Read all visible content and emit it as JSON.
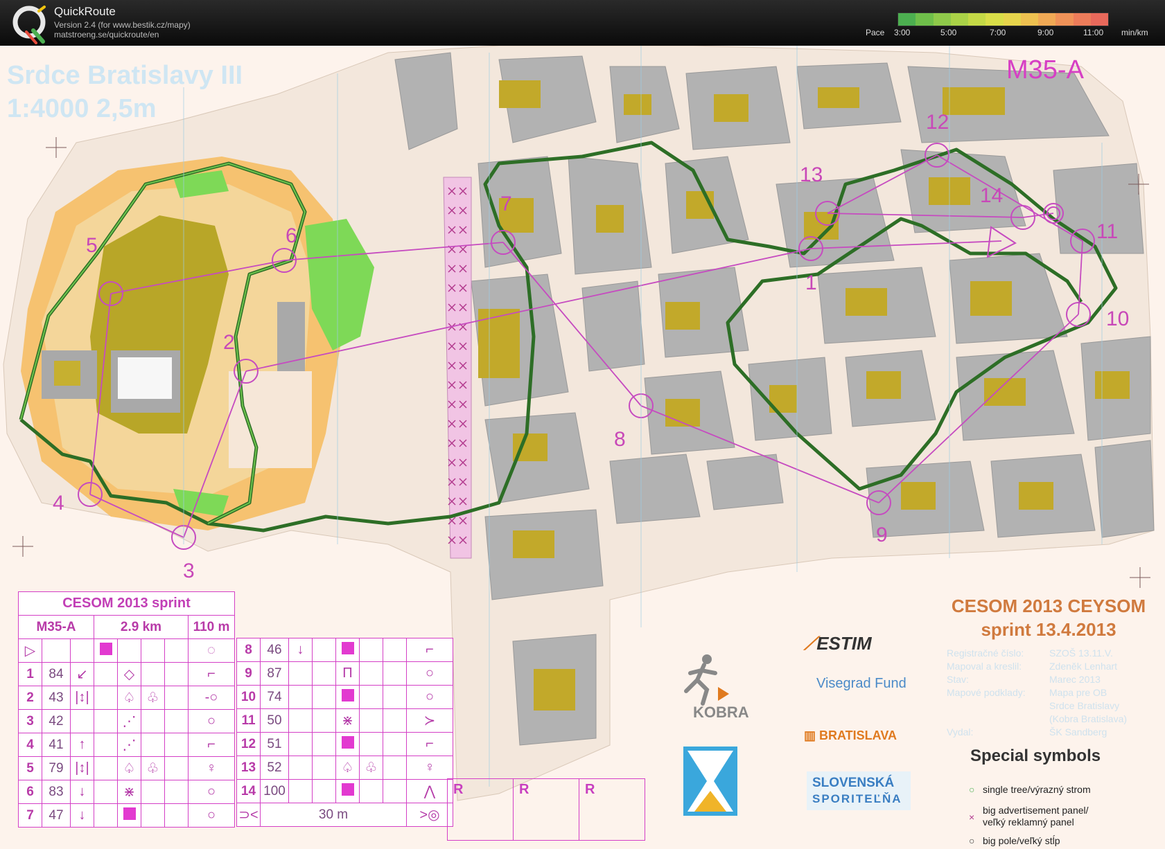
{
  "app": {
    "name": "QuickRoute",
    "version": "Version 2.4  (for www.bestik.cz/mapy)",
    "link": "matstroeng.se/quickroute/en"
  },
  "pace": {
    "label": "Pace",
    "ticks": [
      "3:00",
      "5:00",
      "7:00",
      "9:00",
      "11:00"
    ],
    "unit": "min/km",
    "colors": [
      "#4caf50",
      "#6fbf4a",
      "#8fc94a",
      "#aad247",
      "#c4d946",
      "#d9de48",
      "#e6d54c",
      "#eec150",
      "#f0a955",
      "#ef9258",
      "#ec7c5a",
      "#e8695b"
    ]
  },
  "map": {
    "title": "Srdce Bratislavy III",
    "scale": "1:4000   2,5m",
    "course": "M35-A",
    "controls": [
      "1",
      "2",
      "3",
      "4",
      "5",
      "6",
      "7",
      "8",
      "9",
      "10",
      "11",
      "12",
      "13",
      "14"
    ]
  },
  "description": {
    "title": "CESOM 2013 sprint",
    "class": "M35-A",
    "length": "2.9 km",
    "climb": "110 m",
    "finish_distance": "30 m",
    "rows_left": [
      {
        "n": "1",
        "code": "84",
        "c": "↙",
        "e": "◇",
        "f": "",
        "g": "⌐"
      },
      {
        "n": "2",
        "code": "43",
        "c": "|↕|",
        "e": "♤",
        "f": "♧",
        "g": "-○"
      },
      {
        "n": "3",
        "code": "42",
        "c": "",
        "e": "⋰",
        "f": "",
        "g": "○"
      },
      {
        "n": "4",
        "code": "41",
        "c": "↑",
        "e": "⋰",
        "f": "",
        "g": "⌐"
      },
      {
        "n": "5",
        "code": "79",
        "c": "|↕|",
        "e": "♤",
        "f": "♧",
        "g": "♀"
      },
      {
        "n": "6",
        "code": "83",
        "c": "↓",
        "e": "⋇",
        "f": "",
        "g": "○"
      },
      {
        "n": "7",
        "code": "47",
        "c": "↓",
        "e": "■",
        "f": "",
        "g": "○"
      }
    ],
    "rows_right": [
      {
        "n": "8",
        "code": "46",
        "c": "↓",
        "e": "■",
        "f": "",
        "g": "⌐"
      },
      {
        "n": "9",
        "code": "87",
        "c": "",
        "e": "Π",
        "f": "",
        "g": "○"
      },
      {
        "n": "10",
        "code": "74",
        "c": "",
        "e": "■",
        "f": "",
        "g": "○"
      },
      {
        "n": "11",
        "code": "50",
        "c": "",
        "e": "⋇",
        "f": "",
        "g": "≻"
      },
      {
        "n": "12",
        "code": "51",
        "c": "",
        "e": "■",
        "f": "",
        "g": "⌐"
      },
      {
        "n": "13",
        "code": "52",
        "c": "",
        "e": "♤",
        "f": "♧",
        "g": "♀"
      },
      {
        "n": "14",
        "code": "100",
        "c": "",
        "e": "■",
        "f": "",
        "g": "⋀"
      }
    ],
    "r_labels": [
      "R",
      "R",
      "R"
    ]
  },
  "event": {
    "title_line1": "CESOM 2013 CEYSOM",
    "title_line2": "sprint 13.4.2013",
    "info_labels": [
      "Registračné číslo:",
      "Mapoval a kreslil:",
      "Stav:",
      "Mapové podklady:",
      "",
      "",
      "Vydal:"
    ],
    "info_values": [
      "SZOŠ 13.11.V.",
      "Zdeněk Lenhart",
      "Marec 2013",
      "Mapa pre OB",
      "Srdce Bratislavy",
      "(Kobra Bratislava)",
      "ŠK Sandberg"
    ],
    "special_title": "Special symbols",
    "special_items": [
      "single tree/výrazný strom",
      "big advertisement panel/\nveľký reklamný panel",
      "big pole/veľký stĺp"
    ]
  },
  "sponsors": {
    "estim": "ESTIM",
    "visegrad": "Visegrad Fund",
    "kobra": "KOBRA",
    "bratislava": "BRATISLAVA",
    "slsp1": "SLOVENSKÁ",
    "slsp2": "SPORITEĽŇA"
  }
}
